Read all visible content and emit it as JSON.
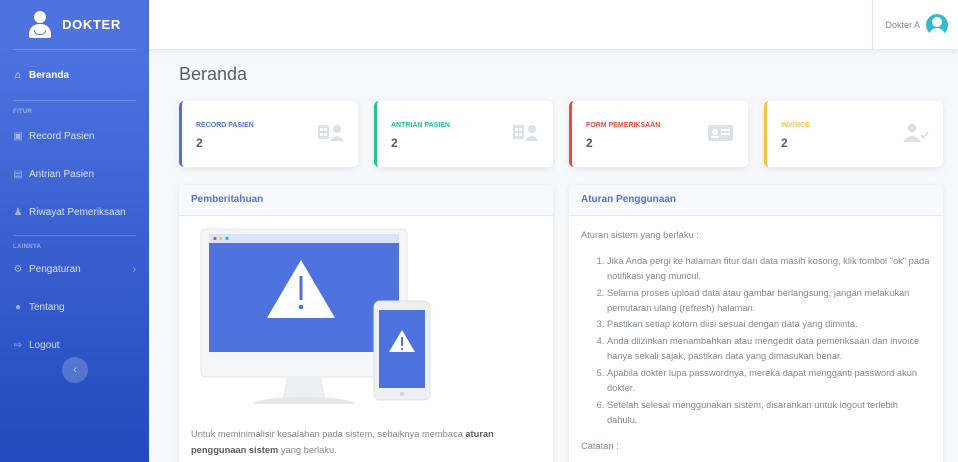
{
  "brand": {
    "name": "DOKTER"
  },
  "sidebar": {
    "dashboard": {
      "label": "Beranda"
    },
    "heading_fitur": "FITUR",
    "items_fitur": [
      {
        "label": "Record Pasien"
      },
      {
        "label": "Antrian Pasien"
      },
      {
        "label": "Riwayat Pemeriksaan"
      }
    ],
    "heading_lainnya": "LAINNYA",
    "items_lainnya": [
      {
        "label": "Pengaturan"
      },
      {
        "label": "Tentang"
      },
      {
        "label": "Logout"
      }
    ]
  },
  "topbar": {
    "user_name": "Dokter A"
  },
  "page": {
    "title": "Beranda"
  },
  "stats": [
    {
      "label": "RECORD PASIEN",
      "value": "2",
      "color": "#4e73df"
    },
    {
      "label": "ANTRIAN PASIEN",
      "value": "2",
      "color": "#1cc88a"
    },
    {
      "label": "FORM PEMERIKSAAN",
      "value": "2",
      "color": "#e74a3b"
    },
    {
      "label": "INVOICE",
      "value": "2",
      "color": "#f6c23e"
    }
  ],
  "notice": {
    "title": "Pemberitahuan",
    "text_pre": "Untuk meminimalisir kesalahan pada sistem, sebaiknya membaca ",
    "text_bold": "aturan penggunaan sistem",
    "text_post": " yang berlaku."
  },
  "rules": {
    "title": "Aturan Penggunaan",
    "intro": "Aturan sistem yang berlaku :",
    "items": [
      "Jika Anda pergi ke halaman fitur dan data masih kosong, klik tombol \"ok\" pada notifikasi yang muncul.",
      "Selama proses upload data atau gambar berlangsung, jangan melakukan pemutaran ulang (refresh) halaman.",
      "Pastikan setiap kolom diisi sesuai dengan data yang diminta.",
      "Anda diizinkan menambahkan atau mengedit data pemeriksaan dan invoice hanya sekali sajak, pastikan data yang dimasukan benar.",
      "Apabila dokter lupa passwordnya, mereka dapat mengganti password akun dokter.",
      "Setelah selesai menggunakan sistem, disarankan untuk logout terlebih dahulu."
    ],
    "note_label": "Catatan :"
  }
}
